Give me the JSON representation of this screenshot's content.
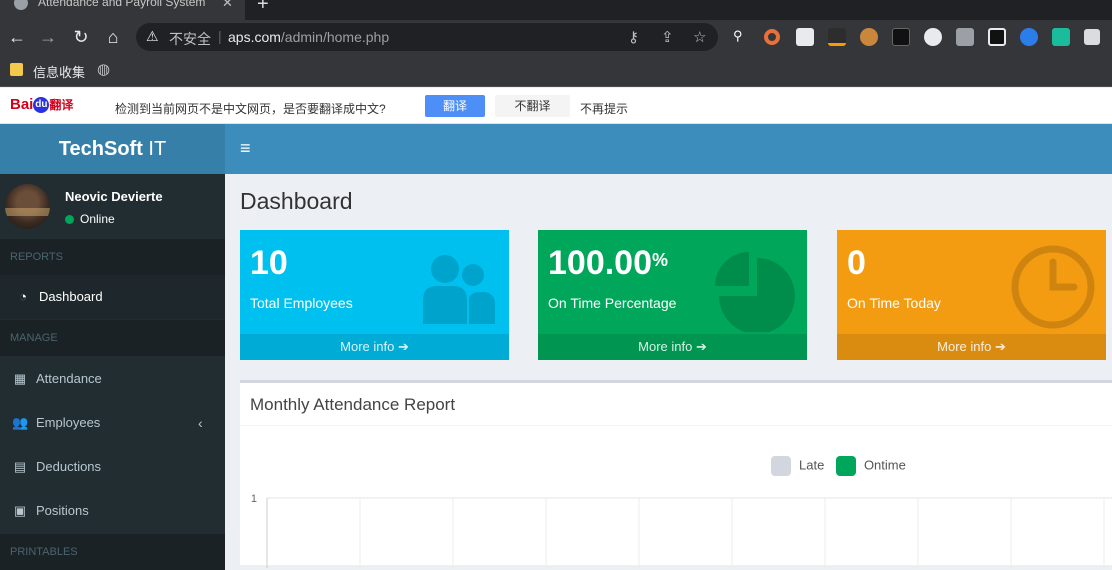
{
  "browser": {
    "tab_title": "Attendance and Payroll System",
    "tab_close": "✕",
    "new_tab": "+",
    "insecure_label": "不安全",
    "url_host": "aps.com",
    "url_path": "/admin/home.php",
    "bookmark_folder": "信息收集"
  },
  "translate_bar": {
    "brand_bai": "Bai",
    "brand_du": "du",
    "brand_fy": "翻译",
    "message": "检测到当前网页不是中文网页，是否要翻译成中文?",
    "translate_button": "翻译",
    "no_translate_button": "不翻译",
    "never_prompt": "不再提示"
  },
  "app": {
    "logo_bold": "TechSoft",
    "logo_light": " IT",
    "menu_icon": "≡"
  },
  "user": {
    "name": "Neovic Devierte",
    "status": "Online"
  },
  "sidebar": {
    "reports_header": "REPORTS",
    "dashboard": "Dashboard",
    "manage_header": "MANAGE",
    "attendance": "Attendance",
    "employees": "Employees",
    "deductions": "Deductions",
    "positions": "Positions",
    "printables_header": "PRINTABLES",
    "chevron": "‹"
  },
  "page": {
    "title": "Dashboard"
  },
  "boxes": {
    "total_employees": {
      "value": "10",
      "label": "Total Employees",
      "more": "More info"
    },
    "on_time_pct": {
      "value": "100.00",
      "suffix": "%",
      "label": "On Time Percentage",
      "more": "More info"
    },
    "on_time_today": {
      "value": "0",
      "label": "On Time Today",
      "more": "More info"
    }
  },
  "colors": {
    "aqua": "#00c0ef",
    "green": "#00a65a",
    "yellow": "#f39c12",
    "topbar": "#3c8dbc",
    "sidebar": "#222d32",
    "late": "#d2d6de",
    "ontime": "#00a65a"
  },
  "report": {
    "title": "Monthly Attendance Report"
  },
  "chart_data": {
    "type": "bar",
    "series": [
      {
        "name": "Late",
        "values": []
      },
      {
        "name": "Ontime",
        "values": []
      }
    ],
    "y_tick_labels": [
      "1"
    ],
    "legend_position": "top-center",
    "grid": true
  }
}
